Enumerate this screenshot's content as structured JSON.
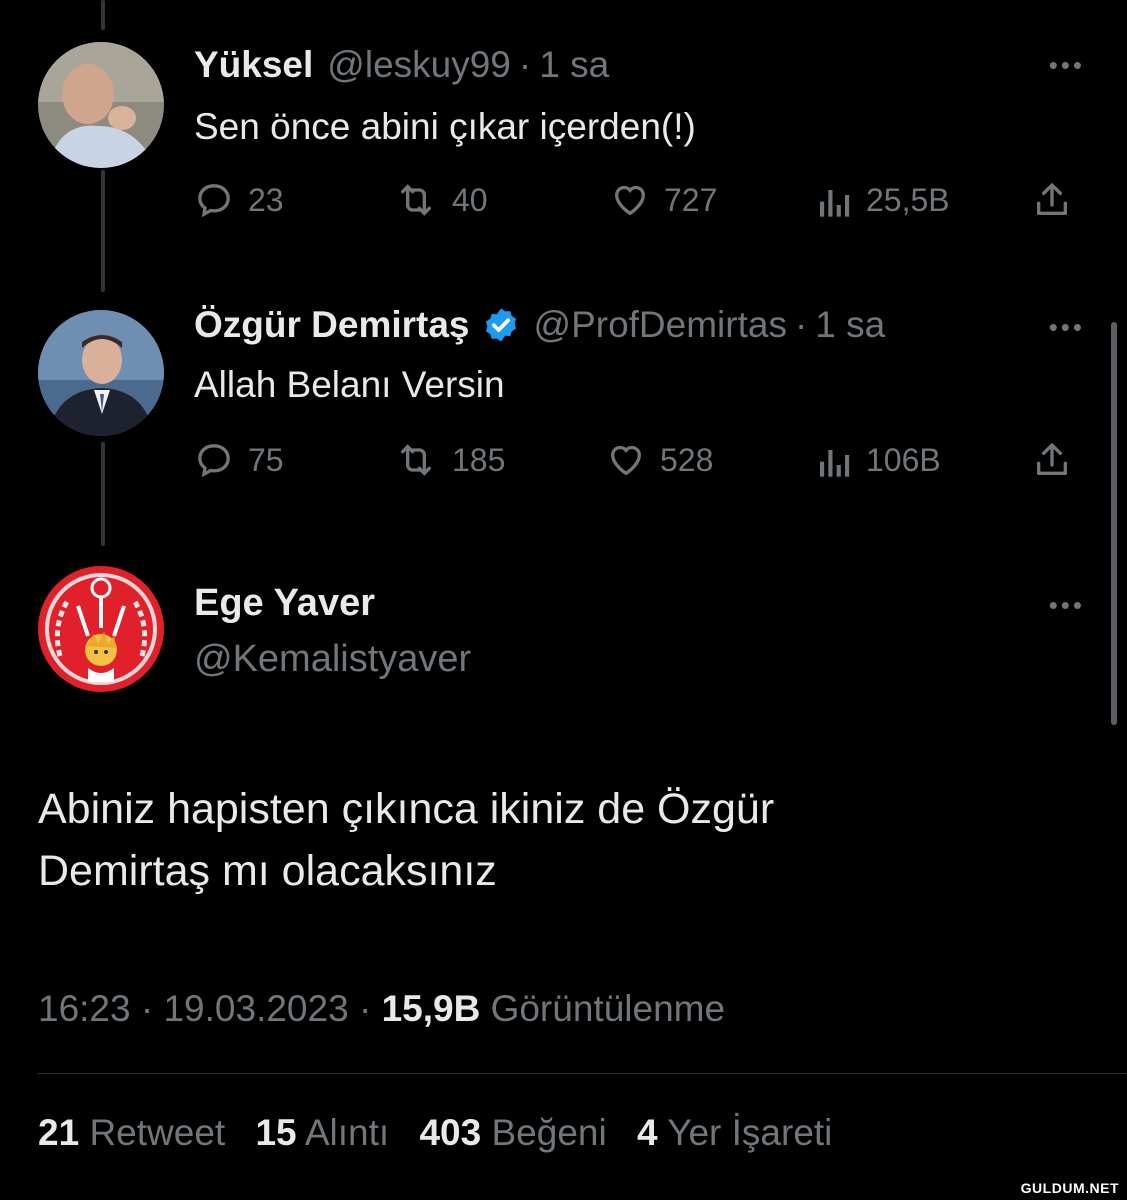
{
  "tweets": [
    {
      "display_name": "Yüksel",
      "handle": "@leskuy99",
      "separator": "·",
      "time": "1 sa",
      "text": "Sen önce abini çıkar içerden(!)",
      "replies": "23",
      "retweets": "40",
      "likes": "727",
      "views": "25,5B",
      "more_icon": "ellipsis-icon"
    },
    {
      "display_name": "Özgür Demirtaş",
      "verified": true,
      "handle": "@ProfDemirtas",
      "separator": "·",
      "time": "1 sa",
      "text": "Allah Belanı Versin",
      "replies": "75",
      "retweets": "185",
      "likes": "528",
      "views": "106B",
      "more_icon": "ellipsis-icon"
    }
  ],
  "main_tweet": {
    "display_name": "Ege Yaver",
    "handle": "@Kemalistyaver",
    "text_line1": "Abiniz hapisten çıkınca ikiniz de Özgür",
    "text_line2": "Demirtaş mı olacaksınız",
    "time": "16:23",
    "date": "19.03.2023",
    "views_count": "15,9B",
    "views_label": "Görüntülenme",
    "dot": "·",
    "stats": {
      "retweets_count": "21",
      "retweets_label": "Retweet",
      "quotes_count": "15",
      "quotes_label": "Alıntı",
      "likes_count": "403",
      "likes_label": "Beğeni",
      "bookmarks_count": "4",
      "bookmarks_label": "Yer İşareti"
    }
  },
  "watermark": "GULDUM.NET",
  "colors": {
    "background": "#000000",
    "text_primary": "#e7e9ea",
    "text_secondary": "#71767b",
    "verified_blue": "#1d9bf0",
    "divider": "#2f3336"
  }
}
